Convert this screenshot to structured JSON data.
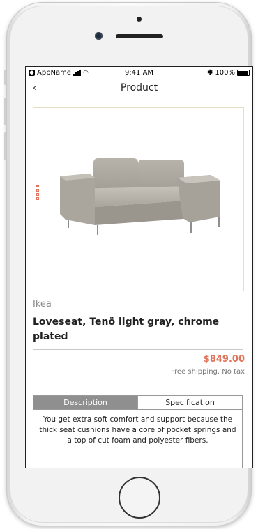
{
  "status_bar": {
    "carrier": "AppName",
    "time": "9:41 AM",
    "battery": "100%"
  },
  "nav": {
    "back_icon": "‹",
    "title": "Product"
  },
  "product": {
    "brand": "Ikea",
    "title": "Loveseat, Tenö light gray, chrome plated",
    "price": "$849.00",
    "shipping": "Free shipping. No tax",
    "image_pages": 4,
    "active_image": 1
  },
  "tabs": [
    {
      "label": "Description",
      "active": true
    },
    {
      "label": "Specification",
      "active": false
    }
  ],
  "description": "You get extra soft comfort and support because the thick seat cushions have a core of pocket springs and a top of cut foam and polyester fibers.",
  "colors": {
    "accent": "#e0735a",
    "tab_active": "#8f8f8f"
  }
}
